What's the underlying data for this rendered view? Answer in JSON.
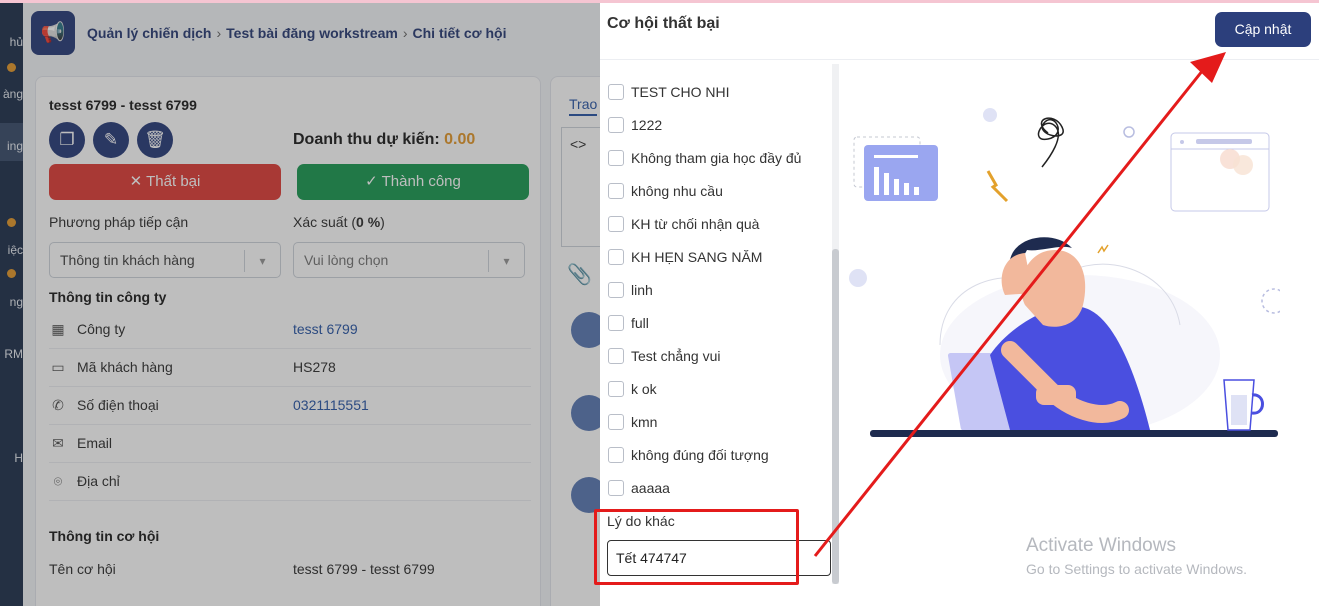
{
  "left_nav": {
    "items": [
      "hủ",
      "àng",
      "ing",
      "iệc",
      "ng",
      "RM",
      "H"
    ]
  },
  "breadcrumb": {
    "items": [
      "Quản lý chiến dịch",
      "Test bài đăng workstream",
      "Chi tiết cơ hội"
    ]
  },
  "opportunity": {
    "title": "tesst 6799 - tesst 6799",
    "revenue_label": "Doanh thu dự kiến:",
    "revenue_value": "0.00",
    "fail_button": "Thất bại",
    "success_button": "Thành công",
    "approach_label": "Phương pháp tiếp cận",
    "approach_value": "Thông tin khách hàng",
    "probability_label": "Xác suất (",
    "probability_value": "0 %",
    "probability_suffix": ")",
    "probability_placeholder": "Vui lòng chọn",
    "company_section": "Thông tin công ty",
    "fields": [
      {
        "icon": "building-icon",
        "label": "Công ty",
        "value": "tesst 6799"
      },
      {
        "icon": "id-card-icon",
        "label": "Mã khách hàng",
        "value": "HS278"
      },
      {
        "icon": "phone-icon",
        "label": "Số điện thoại",
        "value": "0321115551"
      },
      {
        "icon": "email-icon",
        "label": "Email",
        "value": ""
      },
      {
        "icon": "location-icon",
        "label": "Địa chỉ",
        "value": ""
      }
    ],
    "opportunity_section": "Thông tin cơ hội",
    "opportunity_name_label": "Tên cơ hội",
    "opportunity_name_value": "tesst 6799 - tesst 6799"
  },
  "side_panel": {
    "tab_label": "Trao",
    "code_icon": "<>"
  },
  "drawer": {
    "title": "Cơ hội thất bại",
    "update_button": "Cập nhật",
    "reasons": [
      "TEST CHO NHI",
      "1222",
      "Không tham gia học đầy đủ",
      "không nhu cầu",
      "KH từ chối nhận quà",
      "KH HẸN SANG NĂM",
      "linh",
      "full",
      "Test chẳng vui",
      "k ok",
      "kmn",
      "không đúng đối tượng",
      "aaaaa"
    ],
    "other_reason_label": "Lý do khác",
    "other_reason_value": "Tết 474747"
  },
  "watermark": {
    "line1": "Activate Windows",
    "line2": "Go to Settings to activate Windows."
  },
  "colors": {
    "primary": "#2c3f7c",
    "danger": "#e0413b",
    "success": "#1f9b55",
    "accent": "#e49a2e",
    "annotation": "#e41b1b"
  }
}
